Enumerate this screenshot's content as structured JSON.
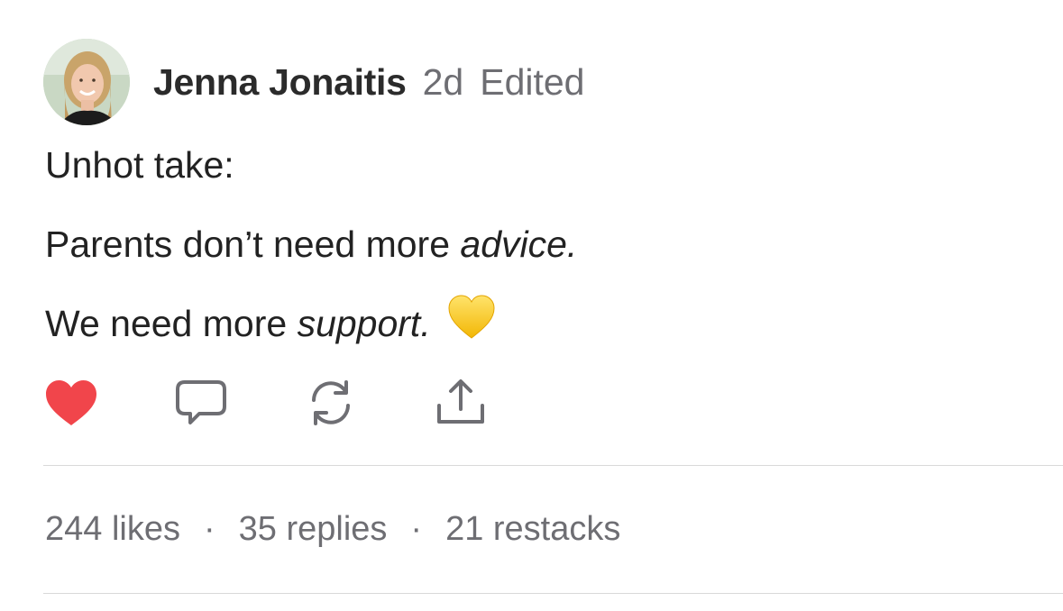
{
  "post": {
    "author": "Jenna Jonaitis",
    "age": "2d",
    "edited_label": "Edited",
    "line1": "Unhot take:",
    "line2_prefix": "Parents don’t need more ",
    "line2_emph": "advice.",
    "line3_prefix": "We need more ",
    "line3_emph": "support.",
    "emoji": "yellow-heart"
  },
  "actions": {
    "like_icon": "heart-icon",
    "reply_icon": "comment-icon",
    "restack_icon": "restack-icon",
    "share_icon": "share-icon",
    "like_color": "#f1454b"
  },
  "stats": {
    "likes": "244 likes",
    "separator": "·",
    "replies": "35 replies",
    "restacks": "21 restacks"
  }
}
